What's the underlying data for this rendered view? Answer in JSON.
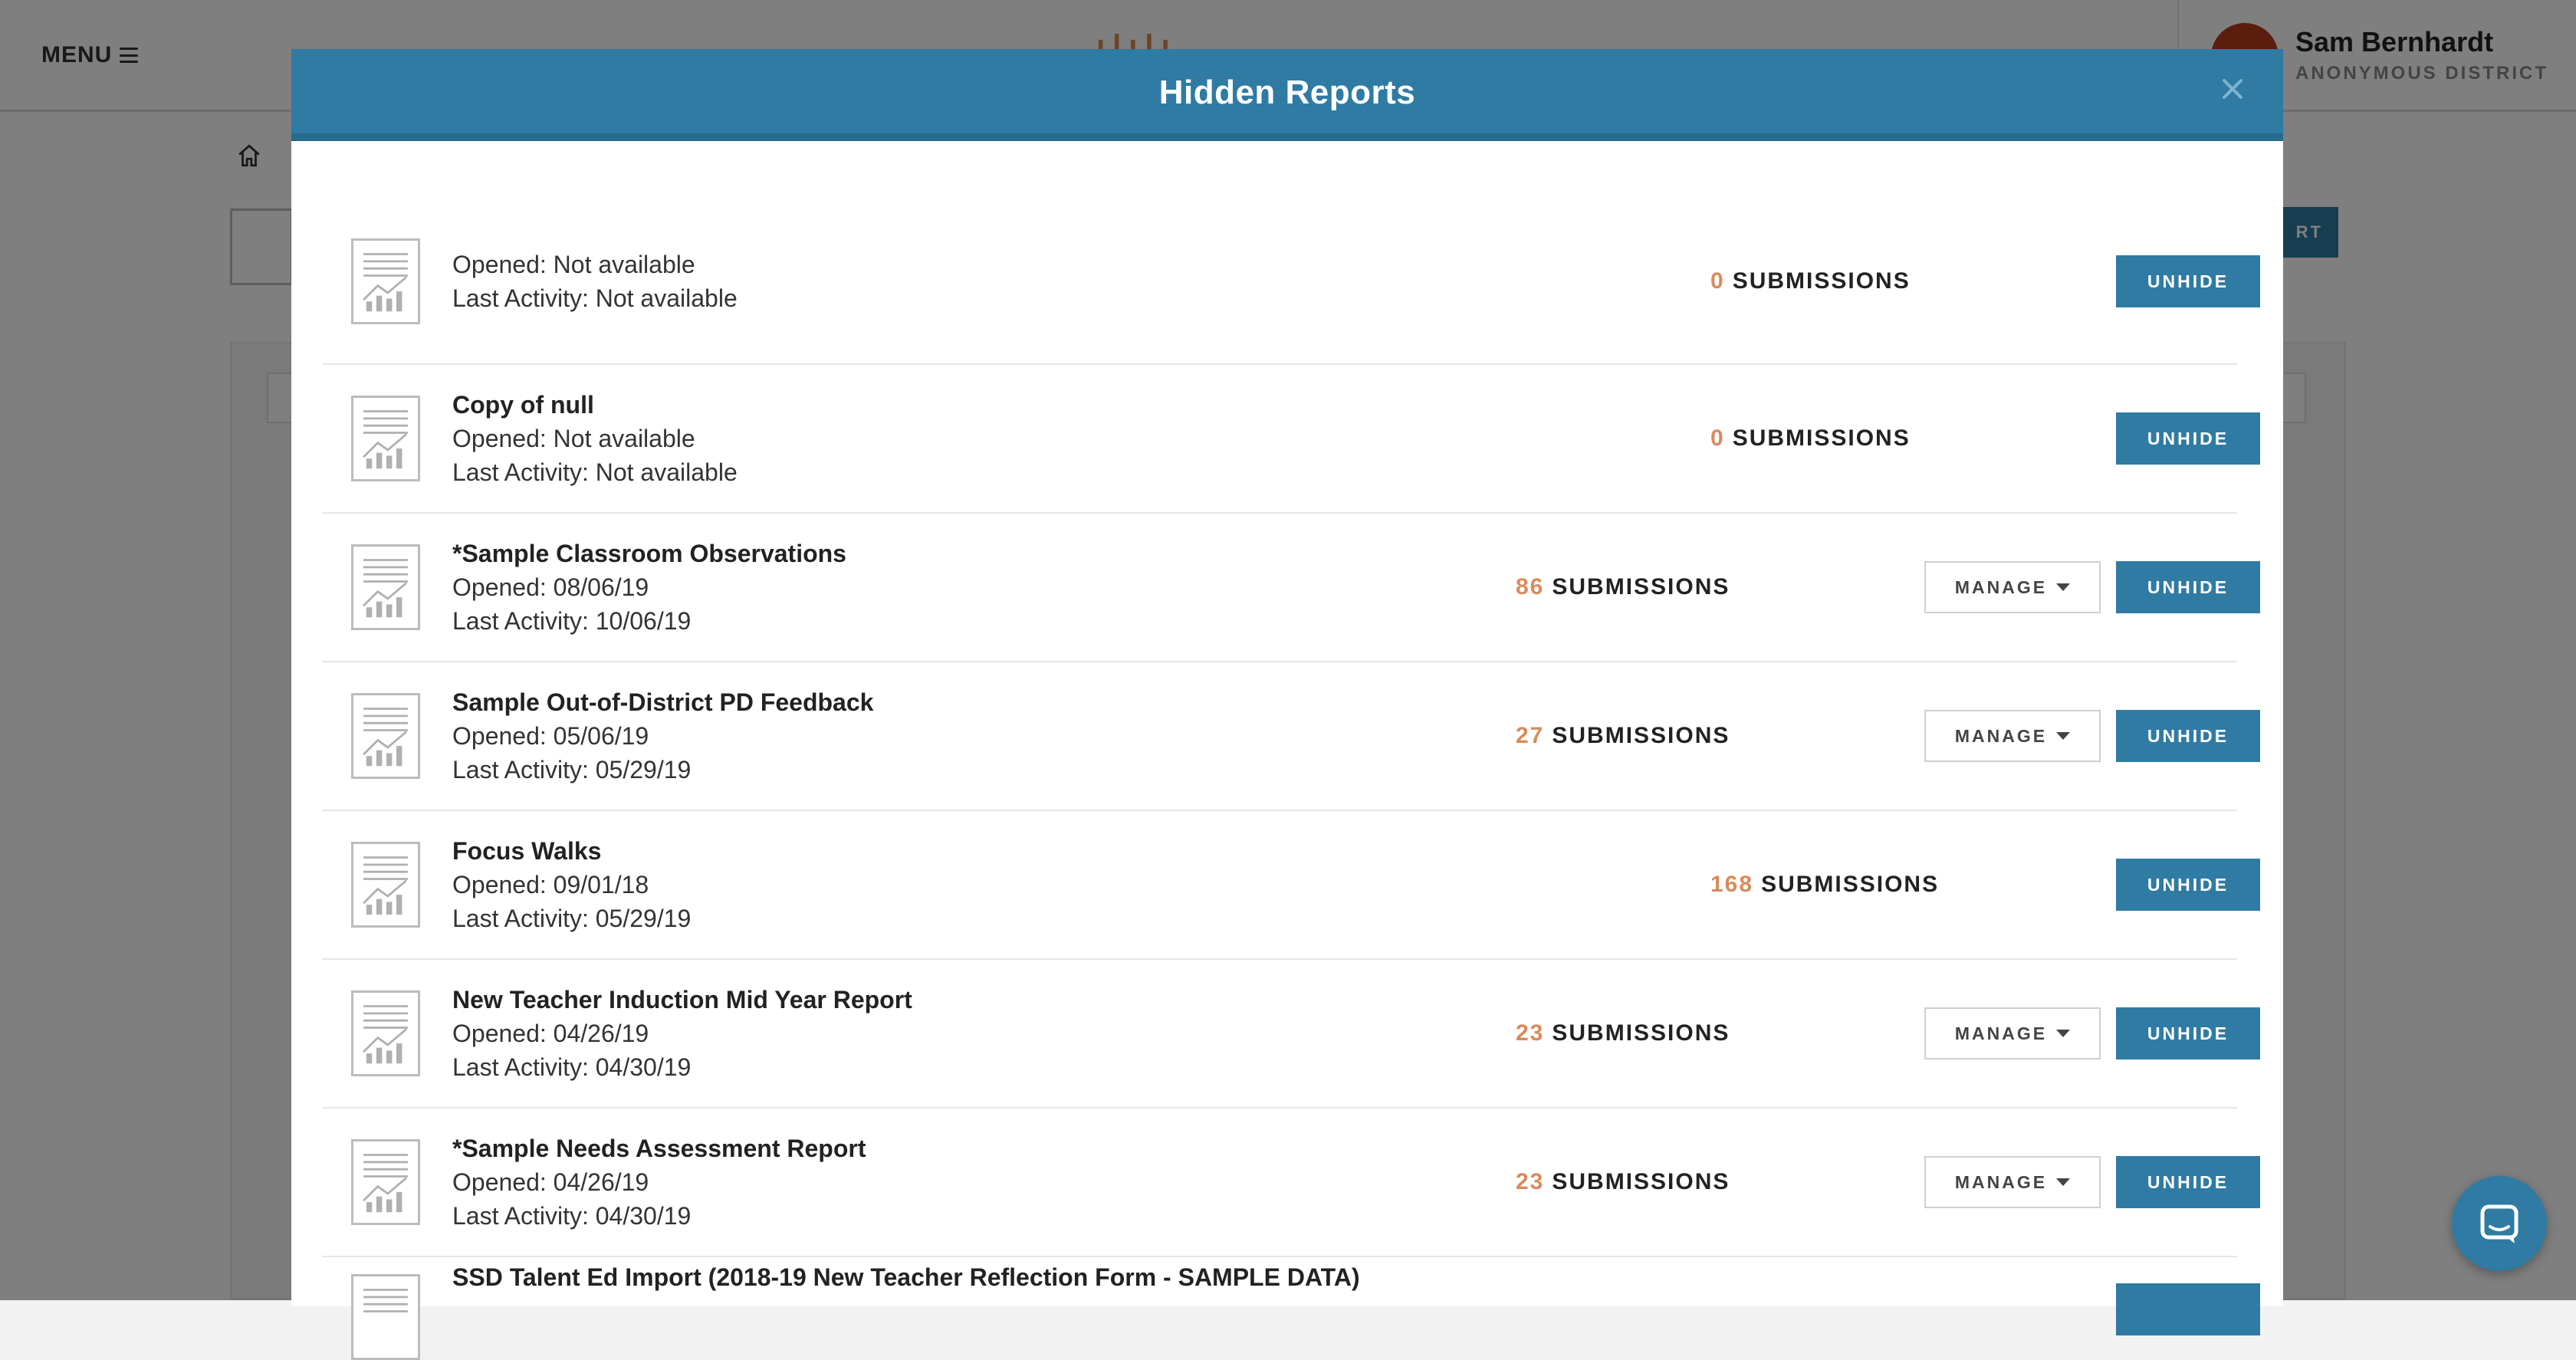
{
  "app": {
    "menu_label": "MENU",
    "logo_text": "ılılı",
    "user_name": "Sam Bernhardt",
    "user_org": "ANONYMOUS DISTRICT",
    "bg_button_label": "RT"
  },
  "modal": {
    "title": "Hidden Reports",
    "reports": [
      {
        "title": "",
        "opened": "Opened: Not available",
        "last_activity": "Last Activity: Not available",
        "count": "0",
        "submissions_label": "SUBMISSIONS",
        "has_manage": false,
        "unhide_label": "UNHIDE"
      },
      {
        "title": "Copy of null",
        "opened": "Opened: Not available",
        "last_activity": "Last Activity: Not available",
        "count": "0",
        "submissions_label": "SUBMISSIONS",
        "has_manage": false,
        "unhide_label": "UNHIDE"
      },
      {
        "title": "*Sample Classroom Observations",
        "opened": "Opened: 08/06/19",
        "last_activity": "Last Activity: 10/06/19",
        "count": "86",
        "submissions_label": "SUBMISSIONS",
        "has_manage": true,
        "manage_label": "MANAGE",
        "unhide_label": "UNHIDE"
      },
      {
        "title": "Sample Out-of-District PD Feedback",
        "opened": "Opened: 05/06/19",
        "last_activity": "Last Activity: 05/29/19",
        "count": "27",
        "submissions_label": "SUBMISSIONS",
        "has_manage": true,
        "manage_label": "MANAGE",
        "unhide_label": "UNHIDE"
      },
      {
        "title": "Focus Walks",
        "opened": "Opened: 09/01/18",
        "last_activity": "Last Activity: 05/29/19",
        "count": "168",
        "submissions_label": "SUBMISSIONS",
        "has_manage": false,
        "unhide_label": "UNHIDE"
      },
      {
        "title": "New Teacher Induction Mid Year Report",
        "opened": "Opened: 04/26/19",
        "last_activity": "Last Activity: 04/30/19",
        "count": "23",
        "submissions_label": "SUBMISSIONS",
        "has_manage": true,
        "manage_label": "MANAGE",
        "unhide_label": "UNHIDE"
      },
      {
        "title": "*Sample Needs Assessment Report",
        "opened": "Opened: 04/26/19",
        "last_activity": "Last Activity: 04/30/19",
        "count": "23",
        "submissions_label": "SUBMISSIONS",
        "has_manage": true,
        "manage_label": "MANAGE",
        "unhide_label": "UNHIDE"
      }
    ],
    "partial_report": {
      "title": "SSD Talent Ed Import (2018-19 New Teacher Reflection Form - SAMPLE DATA)"
    }
  },
  "colors": {
    "primary": "#2f7ba3",
    "count_accent": "#d98a5c",
    "avatar": "#b63a1c"
  }
}
